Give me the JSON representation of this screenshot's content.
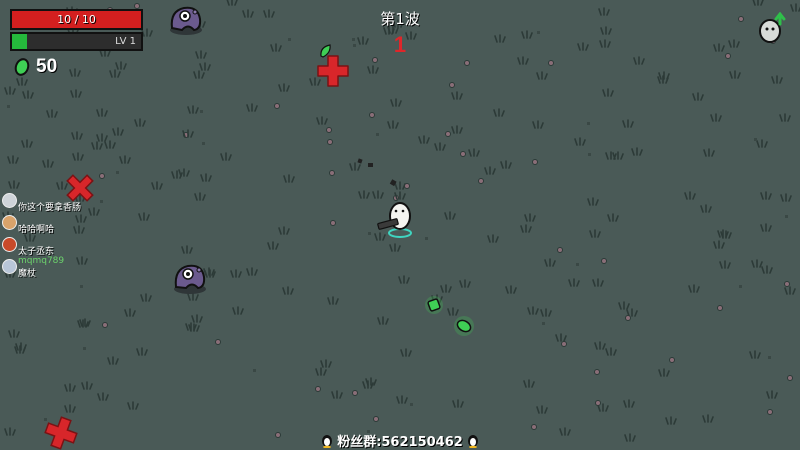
{
  "hud": {
    "hp_text": "10 / 10",
    "hp_current": 10,
    "hp_max": 10,
    "level_text": "LV 1",
    "xp_fraction": 0.12,
    "coins": "50"
  },
  "wave": {
    "title": "第1波",
    "timer": "1"
  },
  "chat": [
    {
      "name": "",
      "message": "你这个要拿香肠",
      "avatar_color": "#cfd4d9"
    },
    {
      "name": "",
      "message": "哈哈啊哈",
      "avatar_color": "#d9a36b"
    },
    {
      "name": "",
      "message": "太子丞东",
      "avatar_color": "#c84a2a"
    },
    {
      "name": "mqmq789",
      "message": "魔杖",
      "avatar_color": "#b8c6d8"
    }
  ],
  "fan_group": "粉丝群:562150462",
  "colors": {
    "hp": "#d31f1f",
    "xp": "#25b93c",
    "ground": "#4a5a57",
    "enemy": "#6b5a8e",
    "danger_mark": "#d8262a",
    "material": "#3fcf55"
  },
  "icons": {
    "coin": "green-material-icon",
    "upgrade": "egg-levelup-icon",
    "penguin": "penguin-icon"
  }
}
